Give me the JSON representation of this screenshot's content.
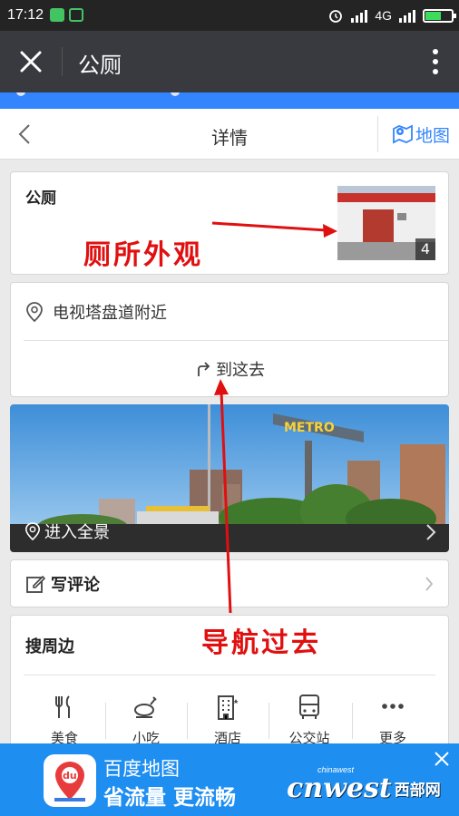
{
  "status_bar": {
    "time": "17:12",
    "network_label": "4G",
    "battery_level": 0.6,
    "icons": [
      "wechat-icon",
      "screenshot-icon",
      "alarm-icon",
      "signal-icon",
      "signal-icon",
      "battery-icon"
    ]
  },
  "app_bar": {
    "title": "公厕",
    "close_icon": "close-icon",
    "more_icon": "more-vertical-icon"
  },
  "nav": {
    "title": "详情",
    "map_label": "地图"
  },
  "place": {
    "name": "公厕",
    "photo_count": "4",
    "address": "电视塔盘道附近",
    "go_label": "到这去"
  },
  "panorama": {
    "label": "进入全景",
    "sign_text": "METRO"
  },
  "review": {
    "label": "写评论"
  },
  "nearby": {
    "title": "搜周边",
    "categories": [
      "美食",
      "小吃",
      "酒店",
      "公交站",
      "更多"
    ]
  },
  "annotations": {
    "exterior": "厕所外观",
    "navigate": "导航过去"
  },
  "banner": {
    "app_name": "百度地图",
    "slogan": "省流量 更流畅",
    "logo_text": "du",
    "watermark_main": "cnwest",
    "watermark_sub": "西部网",
    "watermark_tagline": "chinawest"
  },
  "colors": {
    "accent": "#3385ff",
    "annotation": "#e01010",
    "app_bar": "#393a3f",
    "banner": "#1e8ef0"
  }
}
